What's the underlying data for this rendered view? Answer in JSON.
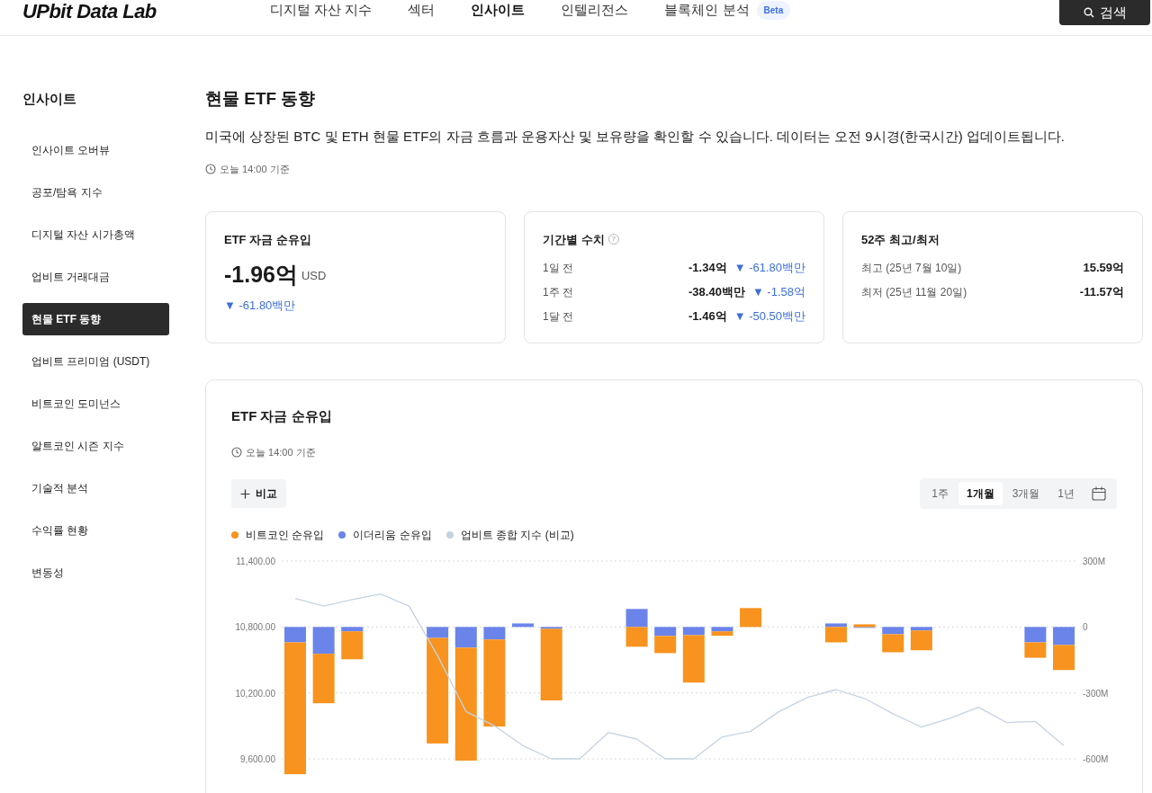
{
  "header": {
    "logo": "UPbit Data Lab",
    "nav": [
      {
        "label": "디지털 자산 지수",
        "selected": false
      },
      {
        "label": "섹터",
        "selected": false
      },
      {
        "label": "인사이트",
        "selected": true
      },
      {
        "label": "인텔리전스",
        "selected": false
      },
      {
        "label": "블록체인 분석",
        "selected": false,
        "badge": "Beta"
      }
    ],
    "search_button": "검색"
  },
  "sidebar": {
    "title": "인사이트",
    "items": [
      {
        "label": "인사이트 오버뷰",
        "selected": false
      },
      {
        "label": "공포/탐욕 지수",
        "selected": false
      },
      {
        "label": "디지털 자산 시가총액",
        "selected": false
      },
      {
        "label": "업비트 거래대금",
        "selected": false
      },
      {
        "label": "현물 ETF 동향",
        "selected": true
      },
      {
        "label": "업비트 프리미엄 (USDT)",
        "selected": false
      },
      {
        "label": "비트코인 도미넌스",
        "selected": false
      },
      {
        "label": "알트코인 시즌 지수",
        "selected": false
      },
      {
        "label": "기술적 분석",
        "selected": false
      },
      {
        "label": "수익률 현황",
        "selected": false
      },
      {
        "label": "변동성",
        "selected": false
      }
    ]
  },
  "page": {
    "title": "현물 ETF 동향",
    "description": "미국에 상장된 BTC 및 ETH 현물 ETF의 자금 흐름과 운용자산 및 보유량을 확인할 수 있습니다. 데이터는 오전 9시경(한국시간) 업데이트됩니다.",
    "timestamp": "오늘 14:00 기준"
  },
  "cards": [
    {
      "kind": "total",
      "title": "ETF 자금 순유입",
      "value": "-1.96억",
      "unit": "USD",
      "change": "▼ -61.80백만"
    },
    {
      "kind": "periods",
      "title": "기간별 수치",
      "help": "?",
      "rows": [
        {
          "label": "1일 전",
          "value": "-1.34억",
          "change": "▼ -61.80백만"
        },
        {
          "label": "1주 전",
          "value": "-38.40백만",
          "change": "▼ -1.58억"
        },
        {
          "label": "1달 전",
          "value": "-1.46억",
          "change": "▼ -50.50백만"
        }
      ]
    },
    {
      "kind": "range",
      "title": "52주 최고/최저",
      "rows": [
        {
          "label": "최고 (25년 7월 10일)",
          "value": "15.59억"
        },
        {
          "label": "최저 (25년 11월 20일)",
          "value": "-11.57억"
        }
      ]
    }
  ],
  "chart_panel": {
    "title": "ETF 자금 순유입",
    "timestamp": "오늘 14:00 기준",
    "compare_button": "비교",
    "ranges": [
      {
        "label": "1주",
        "selected": false
      },
      {
        "label": "1개월",
        "selected": true
      },
      {
        "label": "3개월",
        "selected": false
      },
      {
        "label": "1년",
        "selected": false
      }
    ],
    "chart_data": {
      "type": "bar",
      "stacked": true,
      "ylim": [
        -600,
        300
      ],
      "yticks": [
        {
          "value": 300,
          "label": "300M"
        },
        {
          "value": 0,
          "label": "0"
        },
        {
          "value": -300,
          "label": "-300M"
        },
        {
          "value": -600,
          "label": "-600M"
        }
      ],
      "series": [
        {
          "name": "비트코인 순유입",
          "color": "#f7931e",
          "values": [
            -600,
            -225,
            -127,
            null,
            null,
            -480,
            -514,
            -396,
            0,
            -326,
            null,
            null,
            -90,
            -78,
            -216,
            -20,
            86,
            null,
            null,
            -70,
            12,
            -82,
            -90,
            null,
            null,
            null,
            -70,
            -114
          ]
        },
        {
          "name": "이더리움 순유입",
          "color": "#6b84ea",
          "values": [
            -70,
            -122,
            -20,
            null,
            null,
            -50,
            -94,
            -57,
            16,
            -8,
            null,
            null,
            82,
            -41,
            -37,
            -20,
            0,
            null,
            null,
            16,
            -4,
            -33,
            -16,
            null,
            null,
            null,
            -70,
            -82
          ]
        }
      ]
    },
    "index_chart": {
      "chart_data": {
        "type": "line",
        "ylim": [
          9600,
          11400
        ],
        "yticks": [
          {
            "value": 11400,
            "label": "11,400.00"
          },
          {
            "value": 10800,
            "label": "10,800.00"
          },
          {
            "value": 10200,
            "label": "10,200.00"
          },
          {
            "value": 9600,
            "label": "9,600.00"
          }
        ],
        "series": [
          {
            "name": "업비트 종합 지수 (비교)",
            "color": "#c5d3e0",
            "values": [
              11060,
              10990,
              11050,
              11100,
              10990,
              10540,
              10030,
              9900,
              9720,
              9600,
              9600,
              9840,
              9780,
              9600,
              9600,
              9800,
              9850,
              10030,
              10160,
              10230,
              10150,
              10010,
              9890,
              9970,
              10070,
              9930,
              9940,
              9720
            ]
          }
        ]
      }
    }
  }
}
